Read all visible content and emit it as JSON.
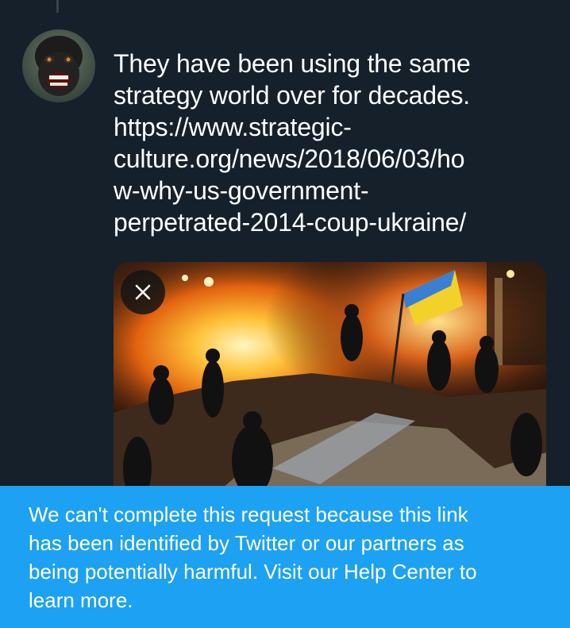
{
  "tweet": {
    "avatar_icon": "monkey-avatar-icon",
    "text_lines": [
      "They have been using the same",
      "strategy world over for decades.",
      "https://www.strategic-",
      "culture.org/news/2018/06/03/ho",
      "w-why-us-government-",
      "perpetrated-2014-coup-ukraine/"
    ],
    "media": {
      "close_icon": "close-icon"
    }
  },
  "warning_banner": {
    "lines": [
      "We can't complete this request because this link",
      "has been identified by Twitter or our partners as",
      "being potentially harmful. Visit our Help Center to",
      "learn more."
    ],
    "background": "#1da1f2"
  },
  "colors": {
    "background": "#15202b",
    "text": "#ffffff",
    "thread_line": "#38444d"
  }
}
